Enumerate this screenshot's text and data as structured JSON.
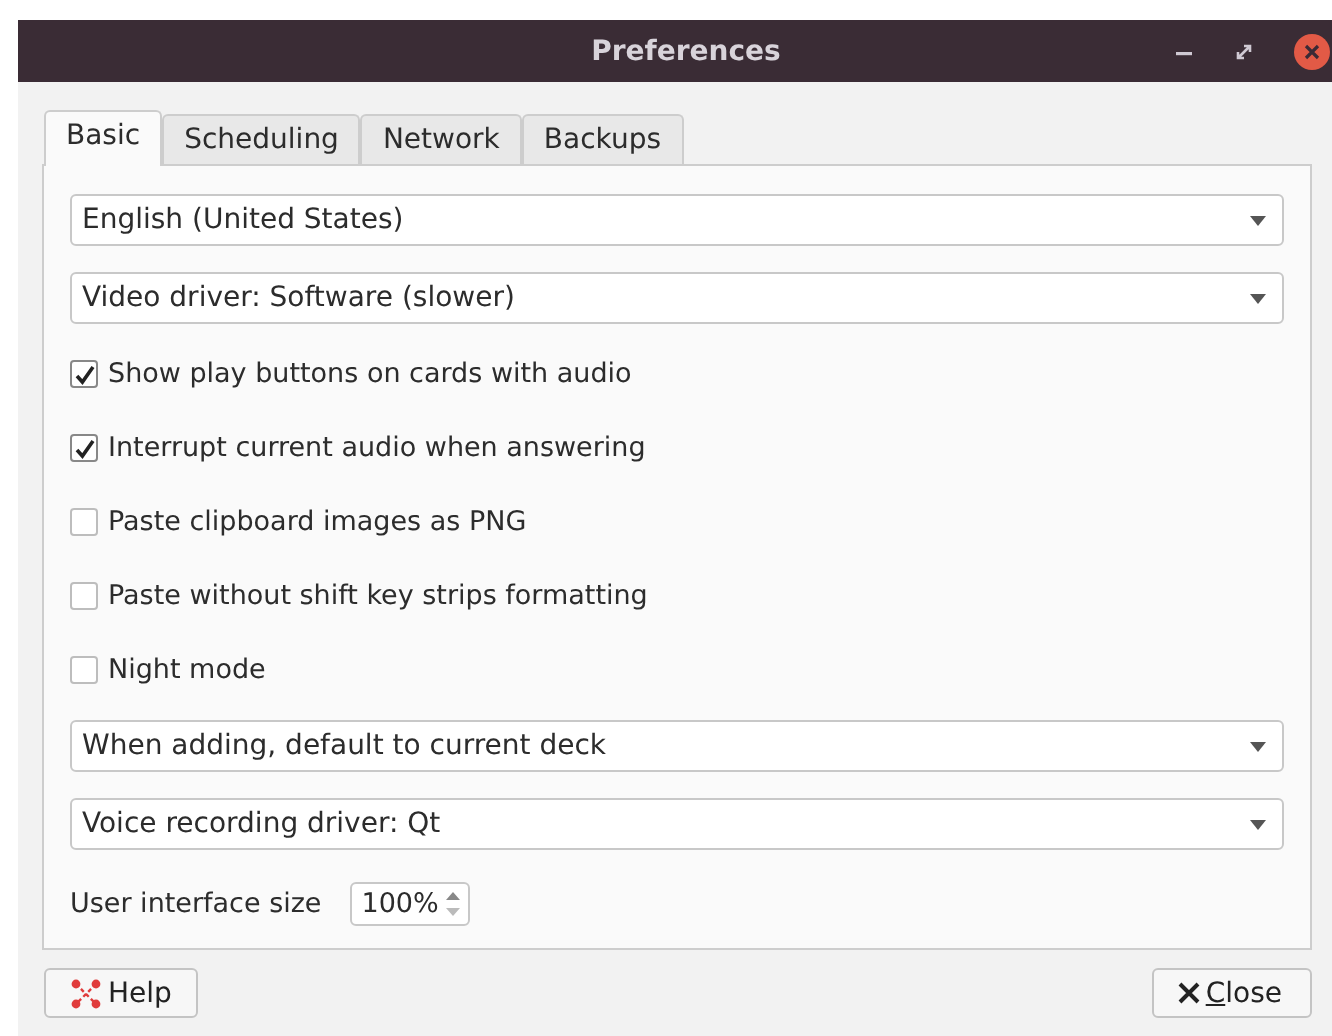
{
  "window": {
    "title": "Preferences"
  },
  "tabs": [
    {
      "label": "Basic",
      "selected": true
    },
    {
      "label": "Scheduling",
      "selected": false
    },
    {
      "label": "Network",
      "selected": false
    },
    {
      "label": "Backups",
      "selected": false
    }
  ],
  "settings": [
    {
      "kind": "dropdown",
      "value": "English (United States)"
    },
    {
      "kind": "dropdown",
      "value": "Video driver: Software (slower)"
    },
    {
      "kind": "checkbox",
      "label": "Show play buttons on cards with audio",
      "checked": true
    },
    {
      "kind": "checkbox",
      "label": "Interrupt current audio when answering",
      "checked": true
    },
    {
      "kind": "checkbox",
      "label": "Paste clipboard images as PNG",
      "checked": false
    },
    {
      "kind": "checkbox",
      "label": "Paste without shift key strips formatting",
      "checked": false
    },
    {
      "kind": "checkbox",
      "label": "Night mode",
      "checked": false
    },
    {
      "kind": "dropdown",
      "value": "When adding, default to current deck"
    },
    {
      "kind": "dropdown",
      "value": "Voice recording driver: Qt"
    },
    {
      "kind": "spinbox",
      "label": "User interface size",
      "value": "100%"
    }
  ],
  "buttons": [
    {
      "kind": "help",
      "label": "Help",
      "mnemonic": false
    },
    {
      "kind": "close",
      "label": "Close",
      "mnemonic": true
    }
  ]
}
